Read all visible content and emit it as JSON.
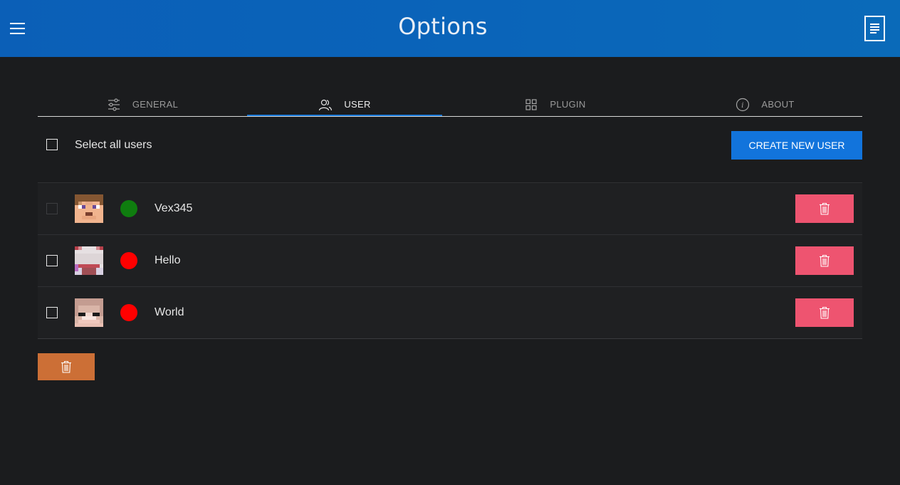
{
  "app_bar": {
    "title": "Options",
    "menu_icon": "hamburger-menu-icon",
    "doc_icon": "document-icon"
  },
  "tabs": [
    {
      "label": "GENERAL",
      "icon": "sliders-icon",
      "active": false
    },
    {
      "label": "USER",
      "icon": "users-icon",
      "active": true
    },
    {
      "label": "PLUGIN",
      "icon": "grid-icon",
      "active": false
    },
    {
      "label": "ABOUT",
      "icon": "info-icon",
      "active": false
    }
  ],
  "user_panel": {
    "select_all_label": "Select all users",
    "create_button_label": "CREATE NEW USER",
    "users": [
      {
        "name": "Vex345",
        "online": true,
        "status_color": "#0f7d0f",
        "checkbox_enabled": false
      },
      {
        "name": "Hello",
        "online": false,
        "status_color": "#ff0000",
        "checkbox_enabled": true
      },
      {
        "name": "World",
        "online": false,
        "status_color": "#ff0000",
        "checkbox_enabled": true
      }
    ]
  },
  "colors": {
    "accent": "#1274dc",
    "delete": "#ee5470",
    "bulk_delete": "#cc6f36",
    "header": "#0a63b9"
  }
}
